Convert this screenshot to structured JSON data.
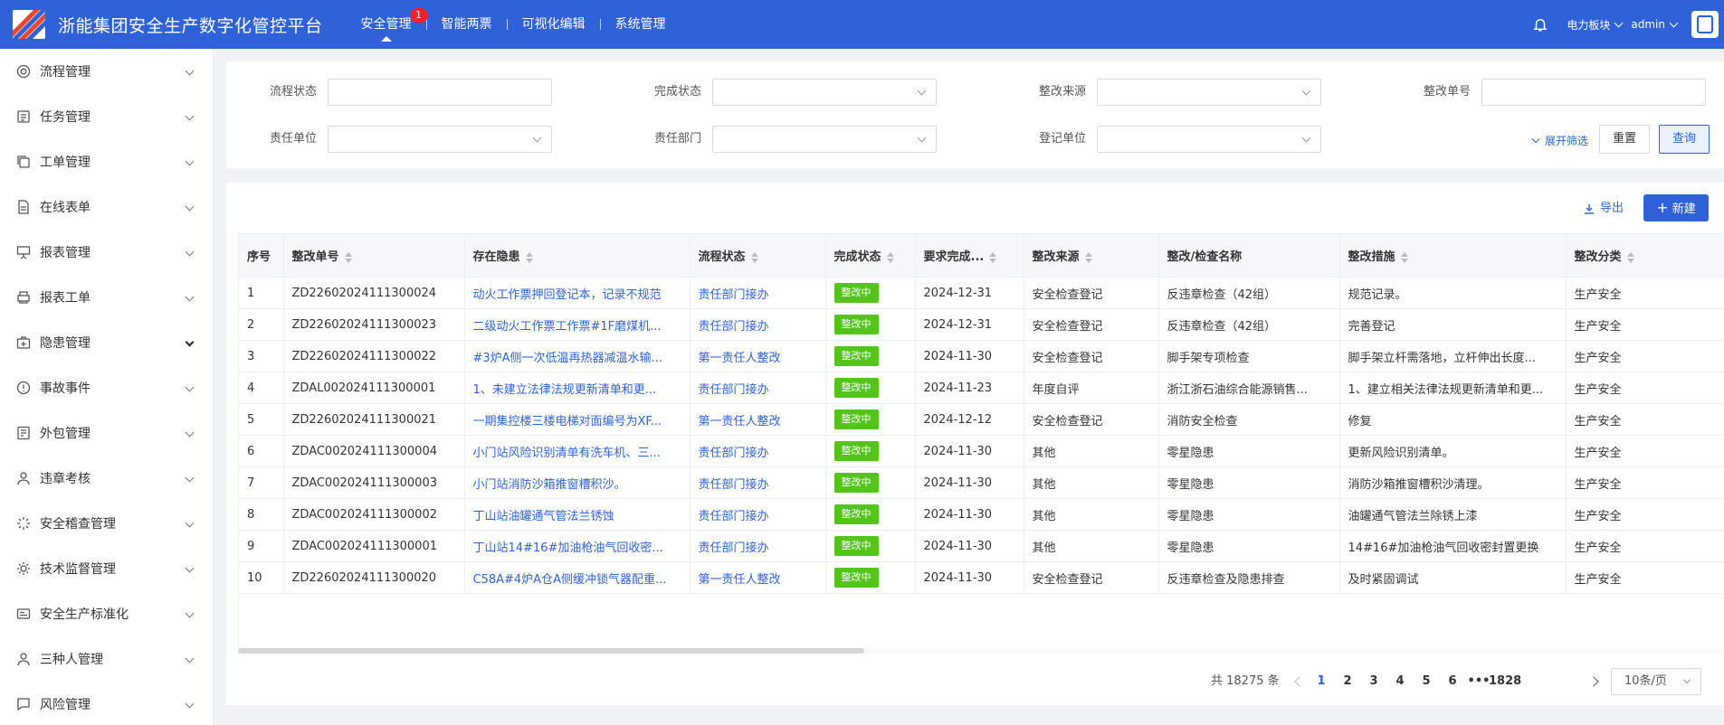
{
  "header": {
    "title": "浙能集团安全生产数字化管控平台",
    "nav": [
      {
        "label": "安全管理",
        "badge": "1",
        "active": true
      },
      {
        "label": "智能两票"
      },
      {
        "label": "可视化编辑"
      },
      {
        "label": "系统管理"
      }
    ],
    "sector": "电力板块",
    "user": "admin",
    "brand_color": "#2f62d9"
  },
  "sidebar": {
    "items": [
      {
        "label": "流程管理",
        "icon": "lifebuoy-icon"
      },
      {
        "label": "任务管理",
        "icon": "tasks-icon"
      },
      {
        "label": "工单管理",
        "icon": "copy-icon"
      },
      {
        "label": "在线表单",
        "icon": "form-icon"
      },
      {
        "label": "报表管理",
        "icon": "presentation-icon"
      },
      {
        "label": "报表工单",
        "icon": "printer-icon"
      },
      {
        "label": "隐患管理",
        "icon": "medkit-icon",
        "active": true
      },
      {
        "label": "事故事件",
        "icon": "alert-icon"
      },
      {
        "label": "外包管理",
        "icon": "contract-icon"
      },
      {
        "label": "违章考核",
        "icon": "person-icon"
      },
      {
        "label": "安全稽查管理",
        "icon": "spark-icon"
      },
      {
        "label": "技术监督管理",
        "icon": "sun-icon"
      },
      {
        "label": "安全生产标准化",
        "icon": "card-icon"
      },
      {
        "label": "三种人管理",
        "icon": "user-icon"
      },
      {
        "label": "风险管理",
        "icon": "chat-icon"
      }
    ]
  },
  "filters": {
    "process_status": "流程状态",
    "complete_status": "完成状态",
    "rectify_source": "整改来源",
    "rectify_no": "整改单号",
    "resp_unit": "责任单位",
    "resp_dept": "责任部门",
    "reg_unit": "登记单位",
    "expand": "展开筛选",
    "reset": "重置",
    "query": "查询"
  },
  "toolbar": {
    "export": "导出",
    "new": "新建"
  },
  "table": {
    "columns": [
      "序号",
      "整改单号",
      "存在隐患",
      "流程状态",
      "完成状态",
      "要求完成...",
      "整改来源",
      "整改/检查名称",
      "整改措施",
      "整改分类"
    ],
    "rows": [
      {
        "no": "1",
        "id": "ZD22602024111300024",
        "hazard": "动火工作票押回登记本，记录不规范",
        "flow": "责任部门接办",
        "status": "整改中",
        "due": "2024-12-31",
        "source": "安全检查登记",
        "check": "反违章检查（42组）",
        "measure": "规范记录。",
        "category": "生产安全"
      },
      {
        "no": "2",
        "id": "ZD22602024111300023",
        "hazard": "二级动火工作票工作票#1F磨煤机...",
        "flow": "责任部门接办",
        "status": "整改中",
        "due": "2024-12-31",
        "source": "安全检查登记",
        "check": "反违章检查（42组）",
        "measure": "完善登记",
        "category": "生产安全"
      },
      {
        "no": "3",
        "id": "ZD22602024111300022",
        "hazard": "#3炉A侧一次低温再热器减温水输...",
        "flow": "第一责任人整改",
        "status": "整改中",
        "due": "2024-11-30",
        "source": "安全检查登记",
        "check": "脚手架专项检查",
        "measure": "脚手架立杆需落地，立杆伸出长度...",
        "category": "生产安全"
      },
      {
        "no": "4",
        "id": "ZDAL002024111300001",
        "hazard": "1、未建立法律法规更新清单和更...",
        "flow": "责任部门接办",
        "status": "整改中",
        "due": "2024-11-23",
        "source": "年度自评",
        "check": "浙江浙石油综合能源销售...",
        "measure": "1、建立相关法律法规更新清单和更...",
        "category": "生产安全"
      },
      {
        "no": "5",
        "id": "ZD22602024111300021",
        "hazard": "一期集控楼三楼电梯对面编号为XF...",
        "flow": "第一责任人整改",
        "status": "整改中",
        "due": "2024-12-12",
        "source": "安全检查登记",
        "check": "消防安全检查",
        "measure": "修复",
        "category": "生产安全"
      },
      {
        "no": "6",
        "id": "ZDAC002024111300004",
        "hazard": "小门站风险识别清单有洗车机、三...",
        "flow": "责任部门接办",
        "status": "整改中",
        "due": "2024-11-30",
        "source": "其他",
        "check": "零星隐患",
        "measure": "更新风险识别清单。",
        "category": "生产安全"
      },
      {
        "no": "7",
        "id": "ZDAC002024111300003",
        "hazard": "小门站消防沙箱推窗槽积沙。",
        "flow": "责任部门接办",
        "status": "整改中",
        "due": "2024-11-30",
        "source": "其他",
        "check": "零星隐患",
        "measure": "消防沙箱推窗槽积沙清理。",
        "category": "生产安全"
      },
      {
        "no": "8",
        "id": "ZDAC002024111300002",
        "hazard": "丁山站油罐通气管法兰锈蚀",
        "flow": "责任部门接办",
        "status": "整改中",
        "due": "2024-11-30",
        "source": "其他",
        "check": "零星隐患",
        "measure": "油罐通气管法兰除锈上漆",
        "category": "生产安全"
      },
      {
        "no": "9",
        "id": "ZDAC002024111300001",
        "hazard": "丁山站14#16#加油枪油气回收密...",
        "flow": "责任部门接办",
        "status": "整改中",
        "due": "2024-11-30",
        "source": "其他",
        "check": "零星隐患",
        "measure": "14#16#加油枪油气回收密封置更换",
        "category": "生产安全"
      },
      {
        "no": "10",
        "id": "ZD22602024111300020",
        "hazard": "C58A#4炉A仓A侧缓冲锁气器配重...",
        "flow": "第一责任人整改",
        "status": "整改中",
        "due": "2024-11-30",
        "source": "安全检查登记",
        "check": "反违章检查及隐患排查",
        "measure": "及时紧固调试",
        "category": "生产安全"
      }
    ]
  },
  "pagination": {
    "total": "共 18275 条",
    "pages": [
      "1",
      "2",
      "3",
      "4",
      "5",
      "6",
      "•••",
      "1828"
    ],
    "current": "1",
    "page_size": "10条/页"
  }
}
